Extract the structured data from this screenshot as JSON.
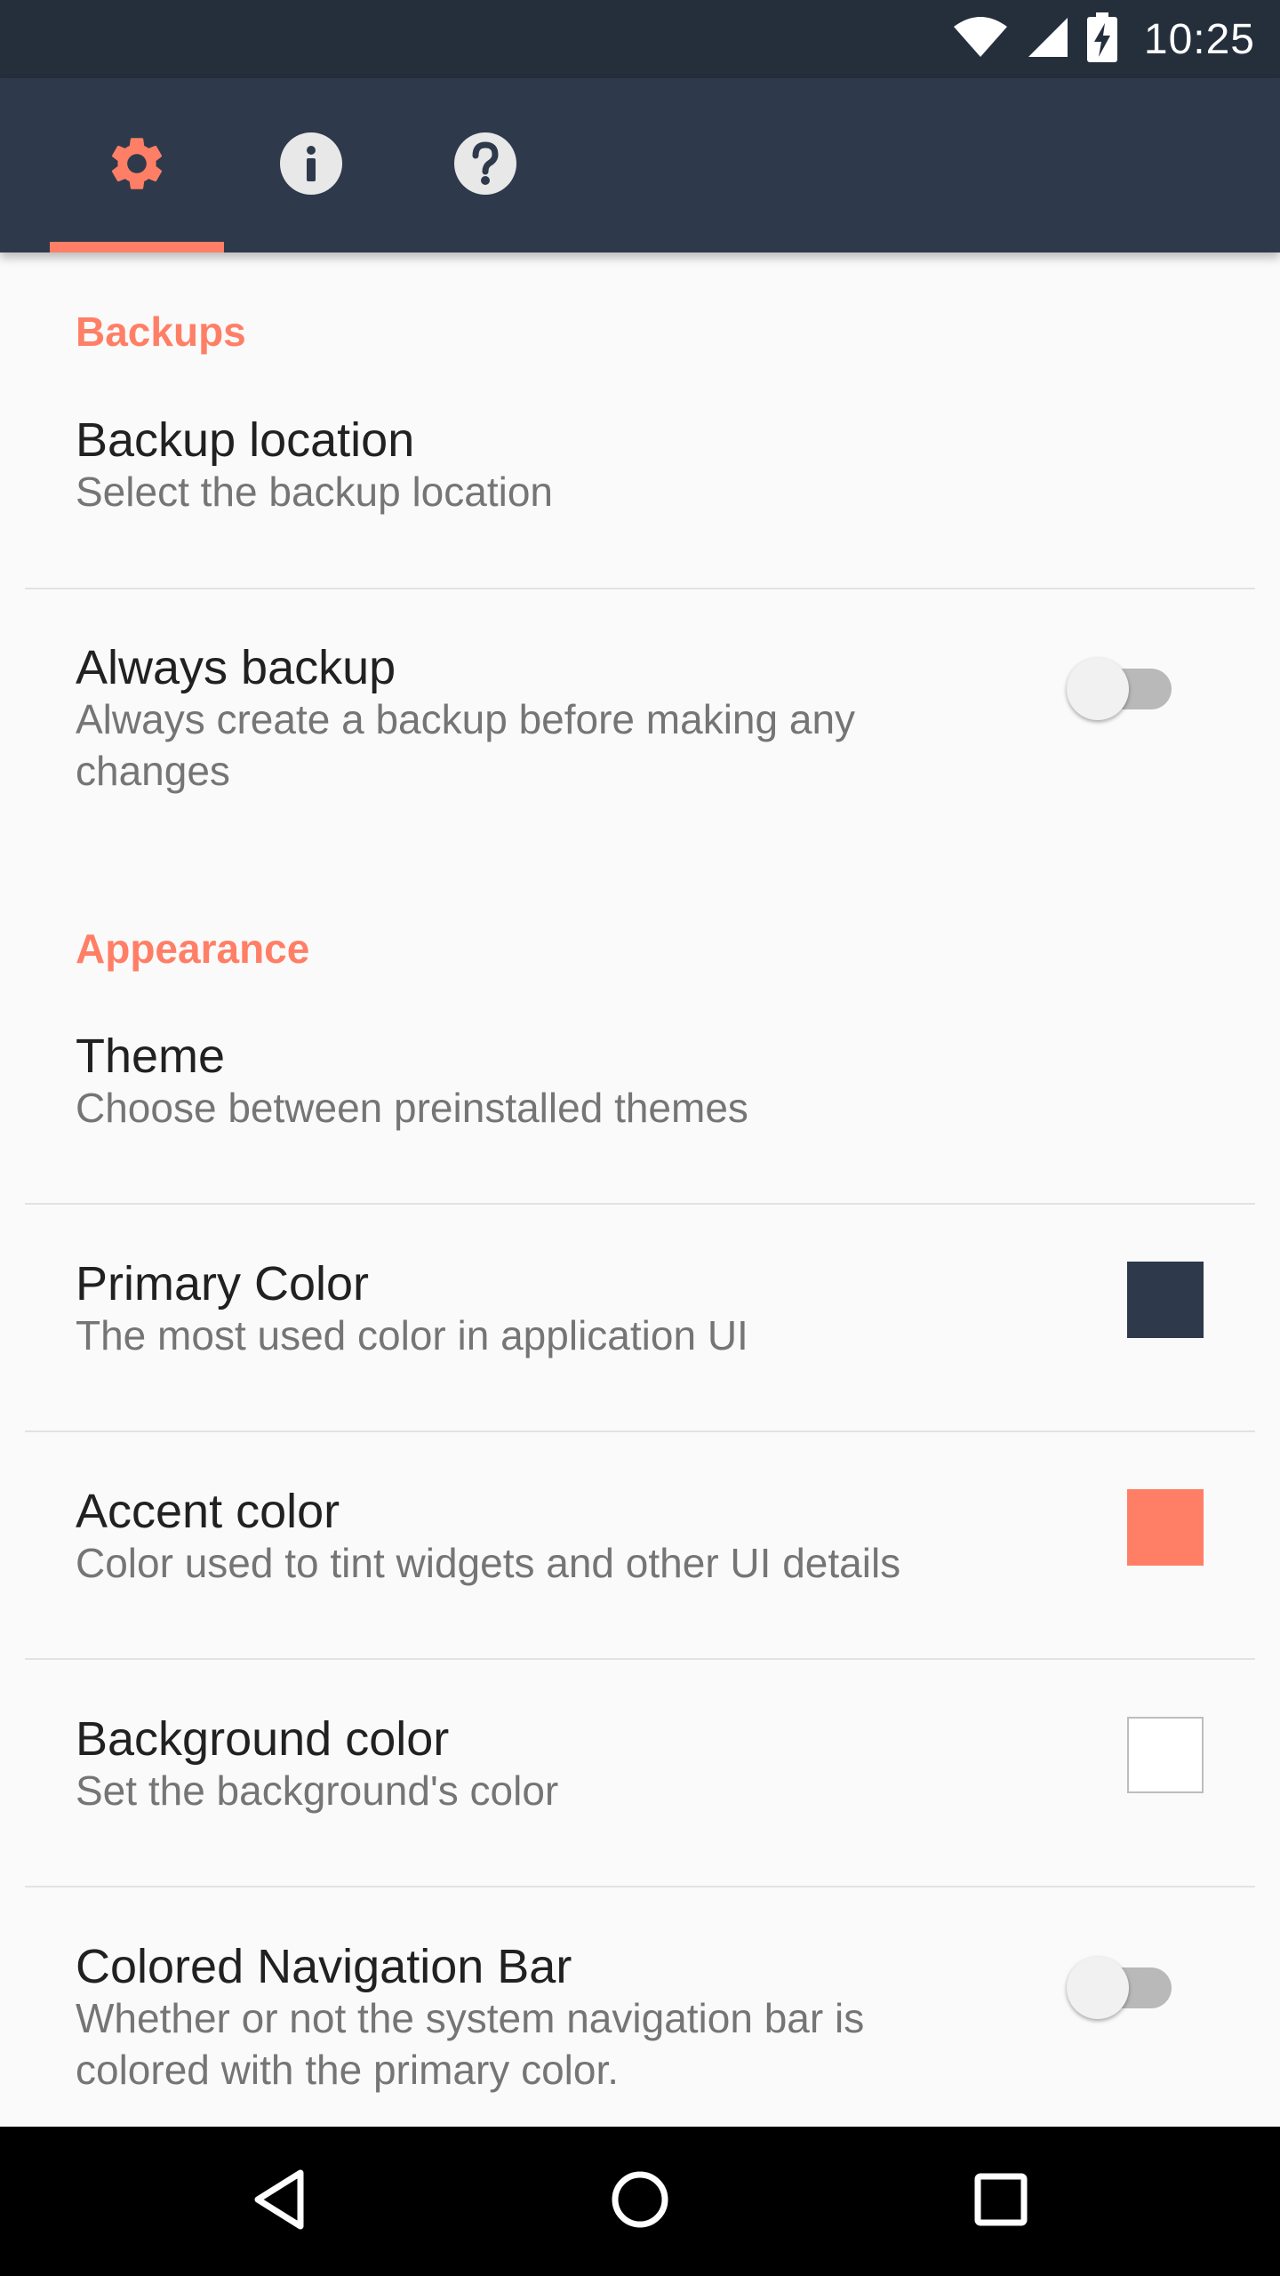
{
  "status_bar": {
    "time": "10:25",
    "icons": [
      "wifi-icon",
      "cell-signal-icon",
      "battery-charging-icon"
    ]
  },
  "toolbar": {
    "tabs": [
      {
        "icon": "gear-icon",
        "selected": true
      },
      {
        "icon": "info-icon",
        "selected": false
      },
      {
        "icon": "help-icon",
        "selected": false
      }
    ]
  },
  "colors": {
    "primary": "#2e3a4b",
    "accent": "#ff7f66",
    "background": "#ffffff"
  },
  "sections": {
    "backups": {
      "header": "Backups",
      "backup_location": {
        "title": "Backup location",
        "summary": "Select the backup location"
      },
      "always_backup": {
        "title": "Always backup",
        "summary": "Always create a backup before making any changes",
        "enabled": false
      }
    },
    "appearance": {
      "header": "Appearance",
      "theme": {
        "title": "Theme",
        "summary": "Choose between preinstalled themes"
      },
      "primary_color": {
        "title": "Primary Color",
        "summary": "The most used color in application UI"
      },
      "accent_color": {
        "title": "Accent color",
        "summary": "Color used to tint widgets and other UI details"
      },
      "background_color": {
        "title": "Background color",
        "summary": "Set the background's color"
      },
      "colored_navigation_bar": {
        "title": "Colored Navigation Bar",
        "summary": "Whether or not the system navigation bar is colored with the primary color.",
        "enabled": false
      }
    }
  },
  "navigation_bar": {
    "buttons": [
      "back-icon",
      "home-icon",
      "recents-icon"
    ]
  }
}
